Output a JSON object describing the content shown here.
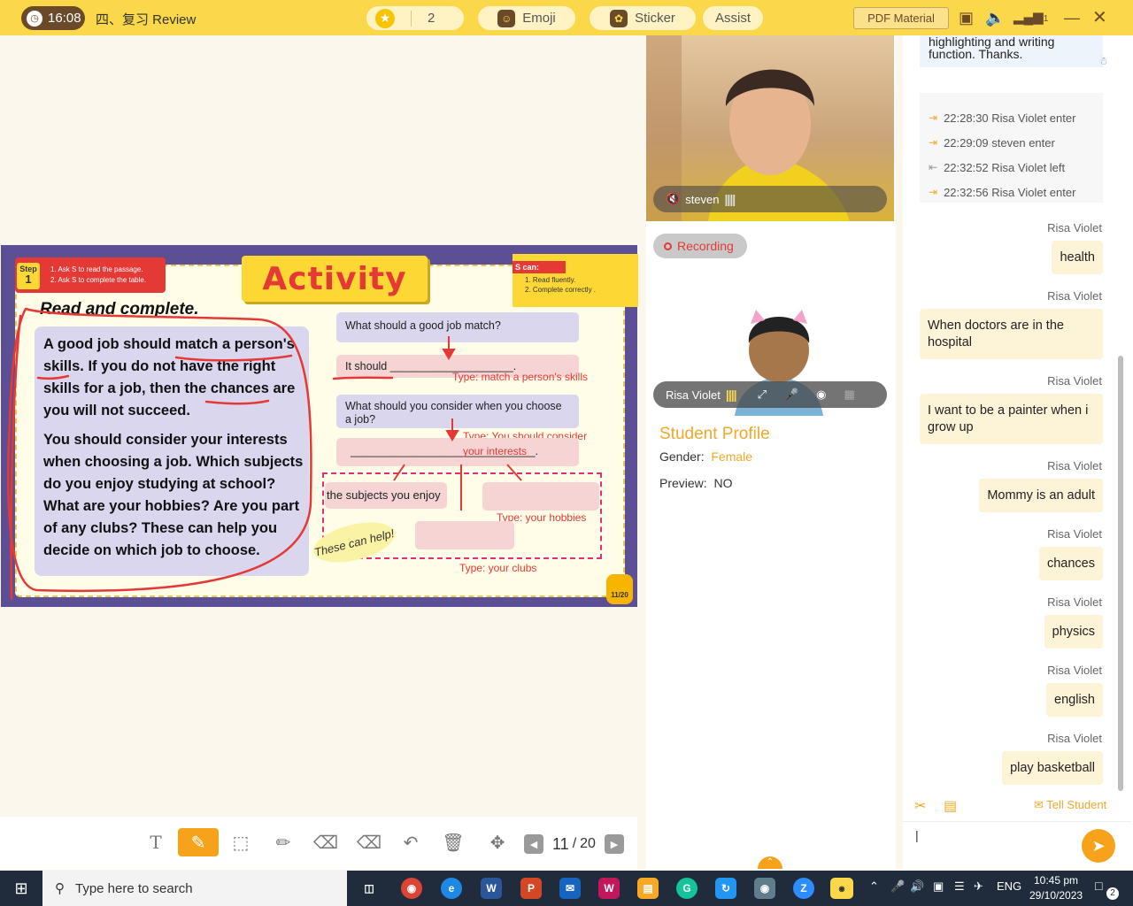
{
  "topbar": {
    "timer": "16:08",
    "lesson_title": "四、复习 Review",
    "stars": "2",
    "emoji_label": "Emoji",
    "sticker_label": "Sticker",
    "assist_label": "Assist",
    "pdf_label": "PDF Material",
    "signal_count": "1",
    "accent_color": "#fbd84a"
  },
  "slide": {
    "step_label": "Step",
    "step_number": "1",
    "step_lines": [
      "1. Ask S to read the passage.",
      "2. Ask S to complete the table."
    ],
    "title": "Activity",
    "scan_label": "S can:",
    "scan_lines": [
      "1. Read fluently.",
      "2. Complete correctly ."
    ],
    "heading": "Read and complete.",
    "passage_p1": "A good job should match a person's skills. If you do not have the right skills for a job, then the chances are you will not succeed.",
    "passage_p2": "You should consider your interests when choosing a job. Which subjects do you enjoy studying at school? What are your hobbies? Are you part of any clubs? These can help you decide on which job to choose.",
    "q1": "What should a good job match?",
    "a1_prefix": "It should",
    "a1_blank": "____________________.",
    "hint1": "Type: match a person's skills",
    "q2": "What should you consider when you choose a job?",
    "a2_blank": "______________________________.",
    "hint2a": "Type: You should consider",
    "hint2b": "your interests",
    "box_subjects": "the subjects you enjoy",
    "hint3": "Type:  your hobbies",
    "hint4": "Type:  your clubs",
    "can_help": "These can help!",
    "page_badge": "11/20"
  },
  "toolbar": {
    "page_current": "11",
    "page_sep": "/",
    "page_total": "20",
    "active_tool": "pen"
  },
  "video": {
    "student_name": "steven",
    "teacher_name": "Risa Violet",
    "recording_label": "Recording"
  },
  "profile": {
    "title": "Student Profile",
    "gender_label": "Gender:",
    "gender_value": "Female",
    "preview_label": "Preview:",
    "preview_value": "NO"
  },
  "chat": {
    "notice_line1": "highlighting and writing",
    "notice_line2": "function. Thanks.",
    "log": [
      {
        "text": "22:28:30 Risa Violet enter",
        "type": "enter"
      },
      {
        "text": "22:29:09 steven enter",
        "type": "enter"
      },
      {
        "text": "22:32:52 Risa Violet left",
        "type": "left"
      },
      {
        "text": "22:32:56 Risa Violet enter",
        "type": "enter"
      }
    ],
    "messages": [
      {
        "sender": "Risa Violet",
        "text": "health"
      },
      {
        "sender": "Risa Violet",
        "text": "When doctors are in the hospital"
      },
      {
        "sender": "Risa Violet",
        "text": "I want to be a painter when i grow up"
      },
      {
        "sender": "Risa Violet",
        "text": "Mommy is an adult"
      },
      {
        "sender": "Risa Violet",
        "text": "chances"
      },
      {
        "sender": "Risa Violet",
        "text": "physics"
      },
      {
        "sender": "Risa Violet",
        "text": "english"
      },
      {
        "sender": "Risa Violet",
        "text": "play basketball"
      }
    ],
    "tell_student": "Tell Student",
    "input_value": "|"
  },
  "taskbar": {
    "search_placeholder": "Type here to search",
    "language": "ENG",
    "time": "10:45 pm",
    "date": "29/10/2023",
    "notification_count": "2"
  }
}
